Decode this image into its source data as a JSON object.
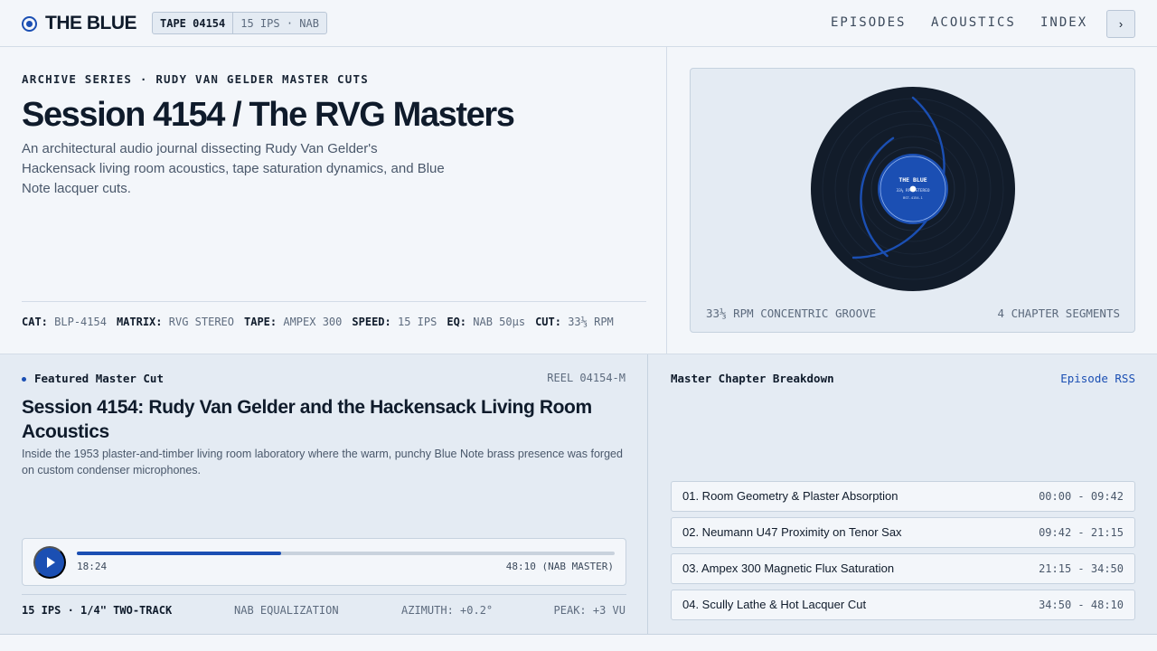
{
  "header": {
    "brand": "THE BLUE",
    "tape_id": "TAPE 04154",
    "tape_spec": "15 IPS · NAB",
    "nav": [
      "EPISODES",
      "ACOUSTICS",
      "INDEX"
    ],
    "nav_button_glyph": "›"
  },
  "hero": {
    "eyebrow": "ARCHIVE SERIES · RUDY VAN GELDER MASTER CUTS",
    "title": "Session 4154 / The RVG Masters",
    "description": "An architectural audio journal dissecting Rudy Van Gelder's Hackensack living room acoustics, tape saturation dynamics, and Blue Note lacquer cuts.",
    "specs": [
      {
        "key": "CAT:",
        "value": "BLP-4154"
      },
      {
        "key": "MATRIX:",
        "value": "RVG STEREO"
      },
      {
        "key": "TAPE:",
        "value": "AMPEX 300"
      },
      {
        "key": "SPEED:",
        "value": "15 IPS"
      },
      {
        "key": "EQ:",
        "value": "NAB 50µs"
      },
      {
        "key": "CUT:",
        "value": "33⅓ RPM"
      }
    ]
  },
  "record": {
    "label_title": "THE BLUE",
    "label_line2": "33⅓ RPM STEREO",
    "label_line3": "BST-4154-1",
    "foot_left": "33⅓ RPM CONCENTRIC GROOVE",
    "foot_right": "4 CHAPTER SEGMENTS"
  },
  "featured": {
    "label": "Featured Master Cut",
    "reel": "REEL 04154-M",
    "title": "Session 4154: Rudy Van Gelder and the Hackensack Living Room Acoustics",
    "description": "Inside the 1953 plaster-and-timber living room laboratory where the warm, punchy Blue Note brass presence was forged on custom condenser microphones.",
    "player": {
      "current": "18:24",
      "total": "48:10 (NAB MASTER)",
      "progress": 0.38
    },
    "meta": [
      "15 IPS · 1/4\" TWO-TRACK",
      "NAB EQUALIZATION",
      "AZIMUTH: +0.2°",
      "PEAK: +3 VU"
    ]
  },
  "chapters": {
    "heading": "Master Chapter Breakdown",
    "rss_label": "Episode RSS",
    "items": [
      {
        "title": "01. Room Geometry & Plaster Absorption",
        "time": "00:00 - 09:42"
      },
      {
        "title": "02. Neumann U47 Proximity on Tenor Sax",
        "time": "09:42 - 21:15"
      },
      {
        "title": "03. Ampex 300 Magnetic Flux Saturation",
        "time": "21:15 - 34:50"
      },
      {
        "title": "04. Scully Lathe & Hot Lacquer Cut",
        "time": "34:50 - 48:10"
      }
    ]
  },
  "colors": {
    "accent": "#1b4fb3",
    "ink": "#0f1b2b",
    "background": "#f3f6fa",
    "panel": "#e4ebf3",
    "vinyl": "#121c2a"
  },
  "icons": {
    "brand": "target-icon",
    "nav_button": "chevron-right-icon",
    "play": "play-icon"
  }
}
